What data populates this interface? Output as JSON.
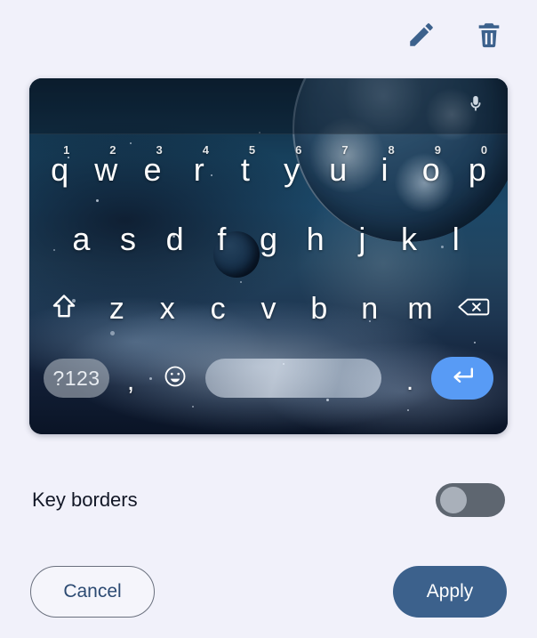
{
  "toolbar": {
    "edit_label": "edit-icon",
    "delete_label": "delete-icon",
    "icon_color": "#3c618c"
  },
  "keyboard_preview": {
    "mic_icon": "microphone-icon",
    "theme_name": "space-planet",
    "rows": [
      {
        "id": "row-letters-top",
        "keys": [
          {
            "letter": "q",
            "num": "1"
          },
          {
            "letter": "w",
            "num": "2"
          },
          {
            "letter": "e",
            "num": "3"
          },
          {
            "letter": "r",
            "num": "4"
          },
          {
            "letter": "t",
            "num": "5"
          },
          {
            "letter": "y",
            "num": "6"
          },
          {
            "letter": "u",
            "num": "7"
          },
          {
            "letter": "i",
            "num": "8"
          },
          {
            "letter": "o",
            "num": "9"
          },
          {
            "letter": "p",
            "num": "0"
          }
        ]
      },
      {
        "id": "row-letters-home",
        "keys": [
          {
            "letter": "a"
          },
          {
            "letter": "s"
          },
          {
            "letter": "d"
          },
          {
            "letter": "f"
          },
          {
            "letter": "g"
          },
          {
            "letter": "h"
          },
          {
            "letter": "j"
          },
          {
            "letter": "k"
          },
          {
            "letter": "l"
          }
        ]
      },
      {
        "id": "row-letters-bottom",
        "shift_icon": "shift-icon",
        "backspace_icon": "backspace-icon",
        "keys": [
          {
            "letter": "z"
          },
          {
            "letter": "x"
          },
          {
            "letter": "c"
          },
          {
            "letter": "v"
          },
          {
            "letter": "b"
          },
          {
            "letter": "n"
          },
          {
            "letter": "m"
          }
        ]
      },
      {
        "id": "row-function",
        "symbols_label": "?123",
        "comma_label": ",",
        "emoji_icon": "emoji-smiley-icon",
        "space_label": "",
        "period_label": ".",
        "enter_icon": "enter-return-icon"
      }
    ],
    "enter_key_color": "#589bf5",
    "symbols_key_color": "#a8b0ba"
  },
  "settings": {
    "key_borders_label": "Key borders",
    "key_borders_state": "off"
  },
  "footer": {
    "cancel_label": "Cancel",
    "apply_label": "Apply",
    "apply_color": "#3c618c"
  }
}
